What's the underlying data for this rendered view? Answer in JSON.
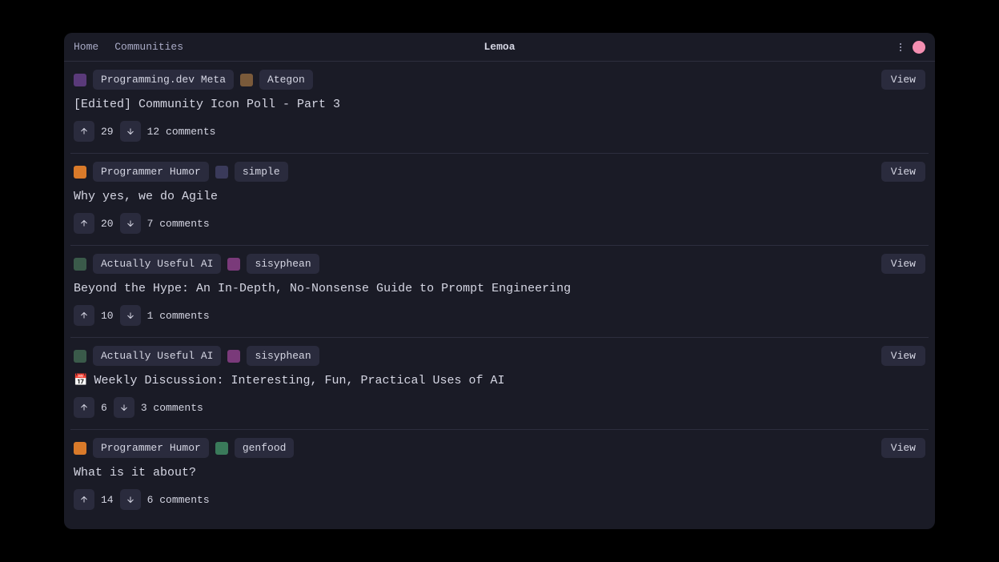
{
  "header": {
    "nav": {
      "home": "Home",
      "communities": "Communities"
    },
    "title": "Lemoa"
  },
  "view_label": "View",
  "posts": [
    {
      "community": "Programming.dev Meta",
      "community_icon_bg": "#5a3a7a",
      "author": "Ategon",
      "author_icon_bg": "#7a5a3a",
      "title": "[Edited] Community Icon Poll - Part 3",
      "title_prefix_emoji": "",
      "score": "29",
      "comments": "12 comments"
    },
    {
      "community": "Programmer Humor",
      "community_icon_bg": "#d97a2a",
      "author": "simple",
      "author_icon_bg": "#3a3a5a",
      "title": "Why yes, we do Agile",
      "title_prefix_emoji": "",
      "score": "20",
      "comments": "7 comments"
    },
    {
      "community": "Actually Useful AI",
      "community_icon_bg": "#3a5a4a",
      "author": "sisyphean",
      "author_icon_bg": "#7a3a7a",
      "title": "Beyond the Hype: An In-Depth, No-Nonsense Guide to Prompt Engineering",
      "title_prefix_emoji": "",
      "score": "10",
      "comments": "1 comments"
    },
    {
      "community": "Actually Useful AI",
      "community_icon_bg": "#3a5a4a",
      "author": "sisyphean",
      "author_icon_bg": "#7a3a7a",
      "title": "Weekly Discussion: Interesting, Fun, Practical Uses of AI",
      "title_prefix_emoji": "📅",
      "score": "6",
      "comments": "3 comments"
    },
    {
      "community": "Programmer Humor",
      "community_icon_bg": "#d97a2a",
      "author": "genfood",
      "author_icon_bg": "#3a7a5a",
      "title": "What is it about?",
      "title_prefix_emoji": "",
      "score": "14",
      "comments": "6 comments"
    }
  ]
}
